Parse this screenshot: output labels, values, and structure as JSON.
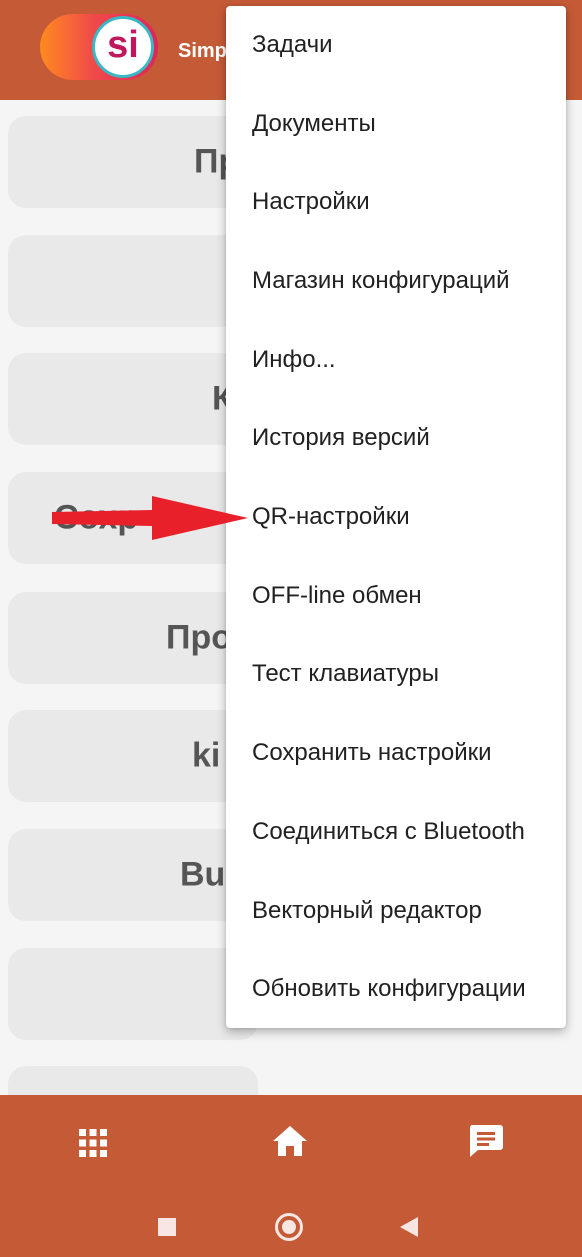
{
  "app": {
    "logo_text": "si",
    "title": "Simp"
  },
  "background_buttons": [
    {
      "label": "Пр"
    },
    {
      "label": ""
    },
    {
      "label": "К"
    },
    {
      "label": "Сохр"
    },
    {
      "label": "Про"
    },
    {
      "label": "ki"
    },
    {
      "label": "Bu"
    },
    {
      "label": ""
    },
    {
      "label": ""
    }
  ],
  "menu": {
    "items": [
      {
        "label": "Задачи"
      },
      {
        "label": "Документы"
      },
      {
        "label": "Настройки"
      },
      {
        "label": "Магазин конфигураций"
      },
      {
        "label": "Инфо..."
      },
      {
        "label": "История версий"
      },
      {
        "label": "QR-настройки"
      },
      {
        "label": "OFF-line обмен"
      },
      {
        "label": "Тест клавиатуры"
      },
      {
        "label": "Сохранить настройки"
      },
      {
        "label": "Соединиться с Bluetooth"
      },
      {
        "label": "Векторный редактор"
      },
      {
        "label": "Обновить конфигурации"
      }
    ]
  },
  "annotation": {
    "arrow_color": "#e8202a",
    "points_to": "QR-настройки"
  },
  "bottom_nav": {
    "items": [
      {
        "icon": "apps-grid-icon"
      },
      {
        "icon": "home-icon"
      },
      {
        "icon": "chat-icon"
      }
    ]
  },
  "system_nav": {
    "items": [
      {
        "icon": "recents-square-icon"
      },
      {
        "icon": "home-circle-icon"
      },
      {
        "icon": "back-triangle-icon"
      }
    ]
  },
  "colors": {
    "brand": "#c55a37",
    "menu_bg": "#ffffff",
    "button_bg": "#e9e9e9"
  }
}
